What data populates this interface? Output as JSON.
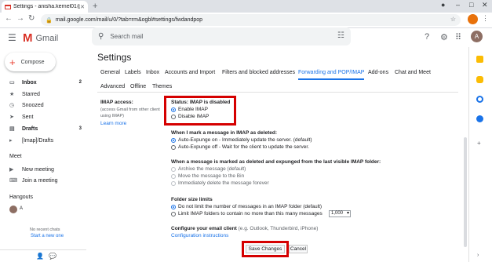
{
  "browser": {
    "tab_title": "Settings - anisha.kernel01@gma...",
    "url": "mail.google.com/mail/u/0/?tab=rm&ogbl#settings/fwdandpop"
  },
  "gmail": {
    "logo_text": "Gmail",
    "search_placeholder": "Search mail",
    "avatar_letter": "A"
  },
  "nav": {
    "compose": "Compose",
    "items": [
      {
        "label": "Inbox",
        "count": "2",
        "icon": "inbox-icon"
      },
      {
        "label": "Starred",
        "count": "",
        "icon": "star-icon"
      },
      {
        "label": "Snoozed",
        "count": "",
        "icon": "clock-icon"
      },
      {
        "label": "Sent",
        "count": "",
        "icon": "send-icon"
      },
      {
        "label": "Drafts",
        "count": "3",
        "icon": "draft-icon"
      },
      {
        "label": "[Imap]/Drafts",
        "count": "",
        "icon": "label-icon"
      }
    ],
    "meet_header": "Meet",
    "meet_items": [
      "New meeting",
      "Join a meeting"
    ],
    "hangouts_header": "Hangouts",
    "hangouts_user": "A",
    "no_recent": "No recent chats",
    "start_new": "Start a new one"
  },
  "settings": {
    "title": "Settings",
    "tabs": [
      "General",
      "Labels",
      "Inbox",
      "Accounts and Import",
      "Filters and blocked addresses",
      "Forwarding and POP/IMAP",
      "Add-ons",
      "Chat and Meet",
      "Advanced",
      "Offline",
      "Themes"
    ],
    "imap_access_label": "IMAP access:",
    "imap_access_desc1": "(access Gmail from other client",
    "imap_access_desc2": "using IMAP)",
    "learn_more": "Learn more",
    "status": "Status: IMAP is disabled",
    "enable_imap": "Enable IMAP",
    "disable_imap": "Disable IMAP",
    "deleted_header": "When I mark a message in IMAP as deleted:",
    "autoexpunge_on": "Auto-Expunge on - Immediately update the server. (default)",
    "autoexpunge_off": "Auto-Expunge off - Wait for the client to update the server.",
    "expunged_header": "When a message is marked as deleted and expunged from the last visible IMAP folder:",
    "archive": "Archive the message (default)",
    "move_bin": "Move the message to the Bin",
    "delete_forever": "Immediately delete the message forever",
    "folder_header": "Folder size limits",
    "no_limit": "Do not limit the number of messages in an IMAP folder (default)",
    "limit": "Limit IMAP folders to contain no more than this many messages",
    "limit_value": "1,000",
    "configure_bold": "Configure your email client",
    "configure_rest": " (e.g. Outlook, Thunderbird, iPhone)",
    "config_link": "Configuration instructions",
    "save": "Save Changes",
    "cancel": "Cancel"
  },
  "colors": {
    "highlight_box": "#d50000",
    "accent": "#1a73e8"
  }
}
